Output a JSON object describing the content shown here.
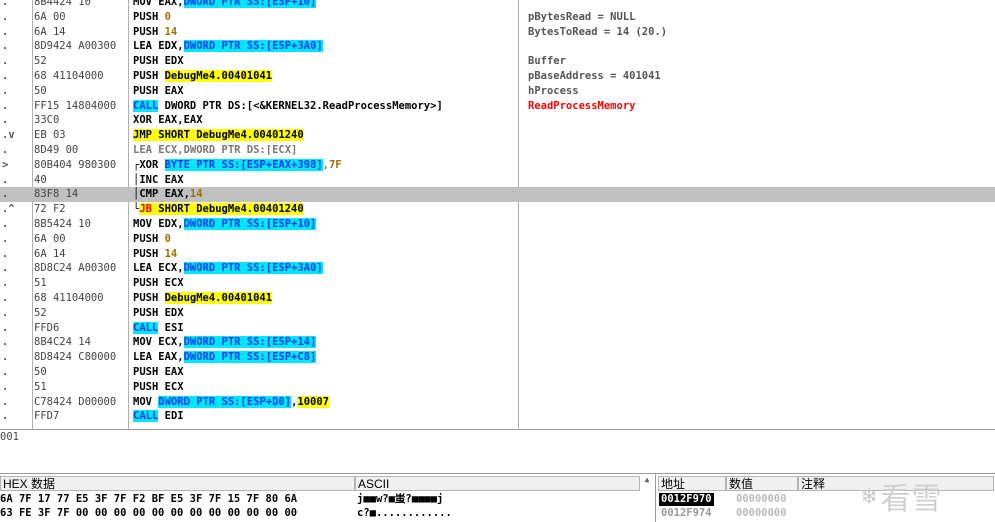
{
  "disasm_rows": [
    {
      "mark": ".",
      "hex": "8B4424 10",
      "dis": [
        {
          "t": "MOV EAX,",
          "c": "n"
        },
        {
          "t": "DWORD PTR SS:[ESP+10]",
          "c": "cyan"
        }
      ],
      "comment": "",
      "ccls": ""
    },
    {
      "mark": ".",
      "hex": "6A 00",
      "dis": [
        {
          "t": "PUSH ",
          "c": "n"
        },
        {
          "t": "0",
          "c": "num"
        }
      ],
      "comment": "pBytesRead = NULL",
      "ccls": ""
    },
    {
      "mark": ".",
      "hex": "6A 14",
      "dis": [
        {
          "t": "PUSH ",
          "c": "n"
        },
        {
          "t": "14",
          "c": "num"
        }
      ],
      "comment": "BytesToRead = 14 (20.)",
      "ccls": ""
    },
    {
      "mark": ".",
      "hex": "8D9424 A00300",
      "dis": [
        {
          "t": "LEA EDX,",
          "c": "n"
        },
        {
          "t": "DWORD PTR SS:[ESP+3A0]",
          "c": "cyan"
        }
      ],
      "comment": "",
      "ccls": ""
    },
    {
      "mark": ".",
      "hex": "52",
      "dis": [
        {
          "t": "PUSH EDX",
          "c": "n"
        }
      ],
      "comment": "Buffer",
      "ccls": ""
    },
    {
      "mark": ".",
      "hex": "68 41104000",
      "dis": [
        {
          "t": "PUSH ",
          "c": "n"
        },
        {
          "t": "DebugMe4.00401041",
          "c": "yellow"
        }
      ],
      "comment": "pBaseAddress = 401041",
      "ccls": ""
    },
    {
      "mark": ".",
      "hex": "50",
      "dis": [
        {
          "t": "PUSH EAX",
          "c": "n"
        }
      ],
      "comment": "hProcess",
      "ccls": ""
    },
    {
      "mark": ".",
      "hex": "FF15 14804000",
      "dis": [
        {
          "t": "CALL",
          "c": "cyan"
        },
        {
          "t": " DWORD PTR DS:[<&KERNEL32.ReadProcessMemory>]",
          "c": "n"
        }
      ],
      "comment": "ReadProcessMemory",
      "ccls": "red"
    },
    {
      "mark": ".",
      "hex": "33C0",
      "dis": [
        {
          "t": "XOR EAX,EAX",
          "c": "n"
        }
      ],
      "comment": "",
      "ccls": ""
    },
    {
      "mark": ".v",
      "hex": "EB 03",
      "dis": [
        {
          "t": "JMP SHORT DebugMe4.00401240",
          "c": "yellow"
        }
      ],
      "comment": "",
      "ccls": ""
    },
    {
      "mark": ".",
      "hex": "8D49 00",
      "dis": [
        {
          "t": "LEA ECX,DWORD PTR DS:[ECX]",
          "c": "gray"
        }
      ],
      "comment": "",
      "ccls": ""
    },
    {
      "mark": ">",
      "hex": "80B404 980300",
      "dis": [
        {
          "t": "┌XOR ",
          "c": "n"
        },
        {
          "t": "BYTE PTR SS:[ESP+EAX+398]",
          "c": "cyan"
        },
        {
          "t": ",7F",
          "c": "num"
        }
      ],
      "comment": "",
      "ccls": ""
    },
    {
      "mark": ".",
      "hex": "40",
      "dis": [
        {
          "t": "│INC EAX",
          "c": "n"
        }
      ],
      "comment": "",
      "ccls": ""
    },
    {
      "mark": ".",
      "hex": "83F8 14",
      "dis": [
        {
          "t": "│CMP EAX,",
          "c": "n"
        },
        {
          "t": "14",
          "c": "num"
        }
      ],
      "comment": "",
      "ccls": "",
      "sel": true
    },
    {
      "mark": ".^",
      "hex": "72 F2",
      "dis": [
        {
          "t": "└",
          "c": "n"
        },
        {
          "t": "JB",
          "c": "yellowred"
        },
        {
          "t": " SHORT DebugMe4.00401240",
          "c": "yellow"
        }
      ],
      "comment": "",
      "ccls": ""
    },
    {
      "mark": ".",
      "hex": "8B5424 10",
      "dis": [
        {
          "t": "MOV EDX,",
          "c": "n"
        },
        {
          "t": "DWORD PTR SS:[ESP+10]",
          "c": "cyan"
        }
      ],
      "comment": "",
      "ccls": ""
    },
    {
      "mark": ".",
      "hex": "6A 00",
      "dis": [
        {
          "t": "PUSH ",
          "c": "n"
        },
        {
          "t": "0",
          "c": "num"
        }
      ],
      "comment": "",
      "ccls": ""
    },
    {
      "mark": ".",
      "hex": "6A 14",
      "dis": [
        {
          "t": "PUSH ",
          "c": "n"
        },
        {
          "t": "14",
          "c": "num"
        }
      ],
      "comment": "",
      "ccls": ""
    },
    {
      "mark": ".",
      "hex": "8D8C24 A00300",
      "dis": [
        {
          "t": "LEA ECX,",
          "c": "n"
        },
        {
          "t": "DWORD PTR SS:[ESP+3A0]",
          "c": "cyan"
        }
      ],
      "comment": "",
      "ccls": ""
    },
    {
      "mark": ".",
      "hex": "51",
      "dis": [
        {
          "t": "PUSH ECX",
          "c": "n"
        }
      ],
      "comment": "",
      "ccls": ""
    },
    {
      "mark": ".",
      "hex": "68 41104000",
      "dis": [
        {
          "t": "PUSH ",
          "c": "n"
        },
        {
          "t": "DebugMe4.00401041",
          "c": "yellow"
        }
      ],
      "comment": "",
      "ccls": ""
    },
    {
      "mark": ".",
      "hex": "52",
      "dis": [
        {
          "t": "PUSH EDX",
          "c": "n"
        }
      ],
      "comment": "",
      "ccls": ""
    },
    {
      "mark": ".",
      "hex": "FFD6",
      "dis": [
        {
          "t": "CALL",
          "c": "cyan"
        },
        {
          "t": " ESI",
          "c": "n"
        }
      ],
      "comment": "",
      "ccls": ""
    },
    {
      "mark": ".",
      "hex": "8B4C24 14",
      "dis": [
        {
          "t": "MOV ECX,",
          "c": "n"
        },
        {
          "t": "DWORD PTR SS:[ESP+14]",
          "c": "cyan"
        }
      ],
      "comment": "",
      "ccls": ""
    },
    {
      "mark": ".",
      "hex": "8D8424 C80000",
      "dis": [
        {
          "t": "LEA EAX,",
          "c": "n"
        },
        {
          "t": "DWORD PTR SS:[ESP+C8]",
          "c": "cyan"
        }
      ],
      "comment": "",
      "ccls": ""
    },
    {
      "mark": ".",
      "hex": "50",
      "dis": [
        {
          "t": "PUSH EAX",
          "c": "n"
        }
      ],
      "comment": "",
      "ccls": ""
    },
    {
      "mark": ".",
      "hex": "51",
      "dis": [
        {
          "t": "PUSH ECX",
          "c": "n"
        }
      ],
      "comment": "",
      "ccls": ""
    },
    {
      "mark": ".",
      "hex": "C78424 D00000",
      "dis": [
        {
          "t": "MOV ",
          "c": "n"
        },
        {
          "t": "DWORD PTR SS:[ESP+D0]",
          "c": "cyan"
        },
        {
          "t": ",",
          "c": "n"
        },
        {
          "t": "10007",
          "c": "yellow"
        }
      ],
      "comment": "",
      "ccls": ""
    },
    {
      "mark": ".",
      "hex": "FFD7",
      "dis": [
        {
          "t": "CALL",
          "c": "cyan"
        },
        {
          "t": " EDI",
          "c": "n"
        }
      ],
      "comment": "",
      "ccls": ""
    }
  ],
  "info_text": "001",
  "dump": {
    "hex_header": "HEX 数据",
    "ascii_header": "ASCII",
    "rows": [
      {
        "hex": "6A 7F 17 77 E5 3F 7F F2 BF E5 3F 7F 15 7F 80 6A",
        "ascii": "j■■w?■蚩?■■■■j"
      },
      {
        "hex": "63 FE 3F 7F 00 00 00 00 00 00 00 00 00 00 00 00",
        "ascii": "c?■............"
      }
    ],
    "scroll_icon": "triangle-up"
  },
  "stack": {
    "headers": {
      "address": "地址",
      "value": "数值",
      "comment": "注释"
    },
    "rows": [
      {
        "address": "0012F970",
        "value": "00000000",
        "selected": true
      },
      {
        "address": "0012F974",
        "value": "00000000",
        "selected": false
      }
    ]
  },
  "watermark": {
    "text": "看雪",
    "icon": "snowflake-icon"
  },
  "colors": {
    "cyan": "#00e8ff",
    "yellow": "#ffff00",
    "selection": "#c0c0c0",
    "red": "#ff0000"
  }
}
